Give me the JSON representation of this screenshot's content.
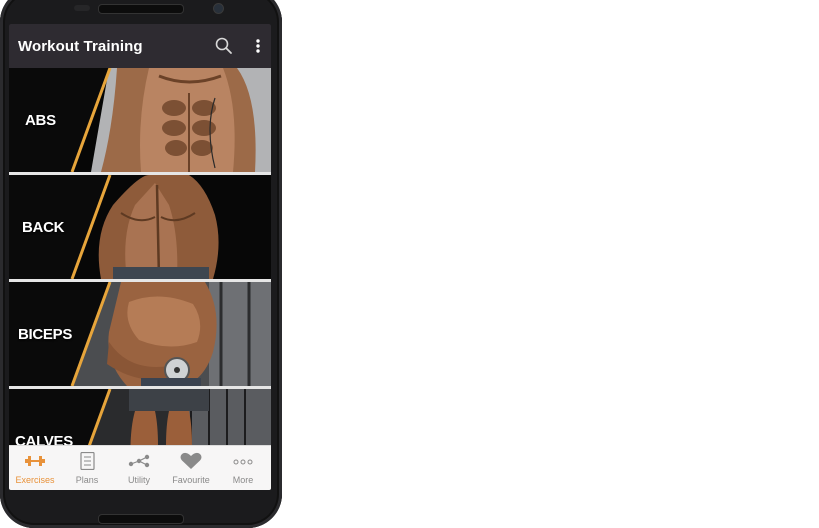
{
  "app": {
    "title": "Workout Training"
  },
  "toolbar": {
    "search_icon": "search-icon",
    "menu_icon": "more-vert-icon"
  },
  "categories": [
    {
      "label": "ABS"
    },
    {
      "label": "BACK"
    },
    {
      "label": "BICEPS"
    },
    {
      "label": "CALVES"
    }
  ],
  "bottom_nav": {
    "active_color": "#e8923a",
    "items": [
      {
        "label": "Exercises",
        "icon": "dumbbell-icon",
        "active": true
      },
      {
        "label": "Plans",
        "icon": "checklist-icon",
        "active": false
      },
      {
        "label": "Utility",
        "icon": "utility-nodes-icon",
        "active": false
      },
      {
        "label": "Favourite",
        "icon": "heart-icon",
        "active": false
      },
      {
        "label": "More",
        "icon": "more-dots-icon",
        "active": false
      }
    ]
  }
}
